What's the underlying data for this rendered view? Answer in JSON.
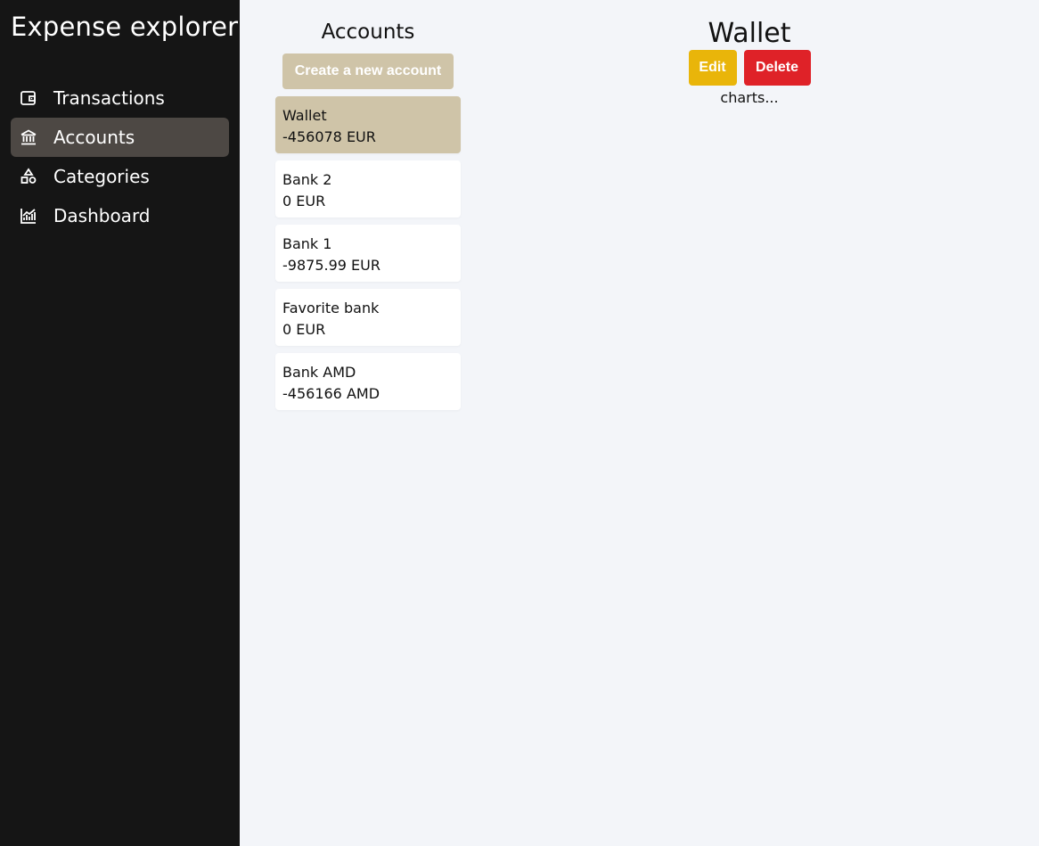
{
  "sidebar": {
    "title": "Expense explorer",
    "items": [
      {
        "label": "Transactions",
        "icon": "wallet-icon"
      },
      {
        "label": "Accounts",
        "icon": "bank-icon",
        "active": true
      },
      {
        "label": "Categories",
        "icon": "shapes-icon"
      },
      {
        "label": "Dashboard",
        "icon": "chart-icon"
      }
    ]
  },
  "accounts": {
    "heading": "Accounts",
    "create_label": "Create a new account",
    "list": [
      {
        "name": "Wallet",
        "balance": "-456078 EUR",
        "active": true
      },
      {
        "name": "Bank 2",
        "balance": "0 EUR"
      },
      {
        "name": "Bank 1",
        "balance": "-9875.99 EUR"
      },
      {
        "name": "Favorite bank",
        "balance": "0 EUR"
      },
      {
        "name": "Bank AMD",
        "balance": "-456166 AMD"
      }
    ]
  },
  "detail": {
    "title": "Wallet",
    "edit_label": "Edit",
    "delete_label": "Delete",
    "charts_text": "charts..."
  },
  "colors": {
    "sidebar_bg": "#151515",
    "active_nav_bg": "#4d4844",
    "accent_tan": "#cfc4a8",
    "edit_yellow": "#e9b50a",
    "delete_red": "#df2228",
    "main_bg": "#f3f5f9"
  }
}
